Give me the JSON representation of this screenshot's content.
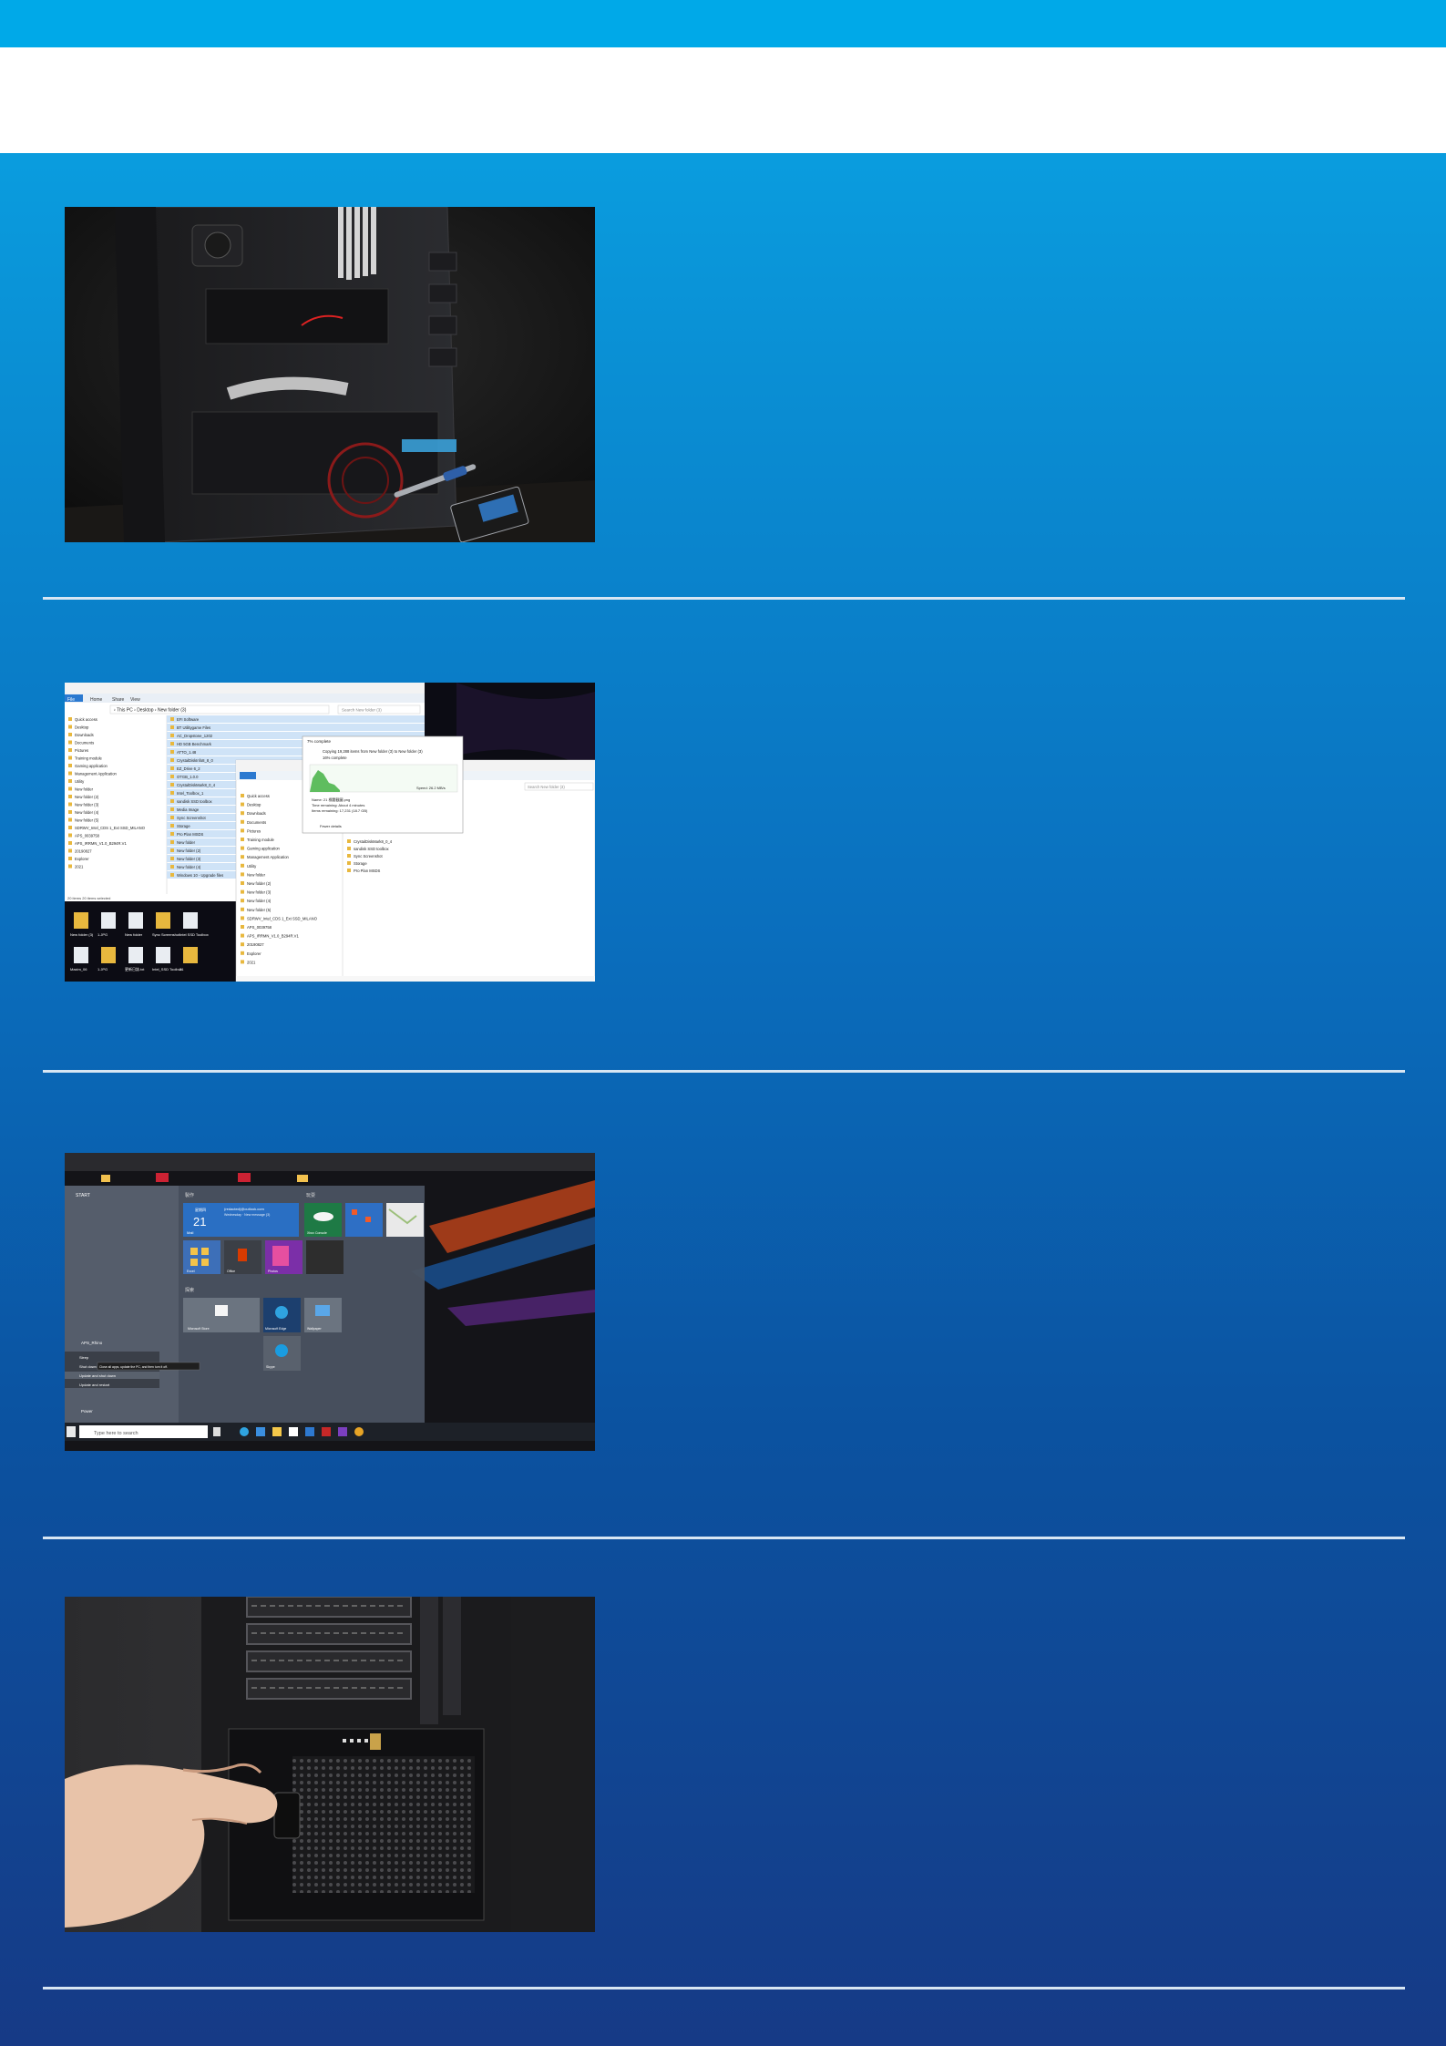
{
  "colors": {
    "top_band": "#00a9e8",
    "white_band": "#ffffff",
    "divider": "#d8e6f3",
    "background_top": "#0aa6e6",
    "background_bottom": "#163a86"
  },
  "panels": [
    {
      "kind": "photo-pc-case-with-ssd"
    },
    {
      "kind": "screenshot-file-copy",
      "explorer_back": {
        "menu": [
          "File",
          "Home",
          "Share",
          "View"
        ],
        "path": "› This PC › Desktop › New folder (3)",
        "search": "Search New folder (3)",
        "nav": [
          "Quick access",
          "Desktop",
          "Downloads",
          "Documents",
          "Pictures",
          "Training module",
          "Gaming application",
          "Management Application",
          "Utility",
          "New folder",
          "New folder (2)",
          "New folder (3)",
          "New folder (4)",
          "New folder (5)",
          "SDRWV_Intel_CDS 1_Ext SSD_MILANO",
          "APS_0039758",
          "APS_IRRMN_V1.0_B294R.V1",
          "20190827",
          "Explorer",
          "2021"
        ],
        "status": "20 items    20 items selected",
        "files": [
          "EFI Software",
          "BT Utilitygame Files",
          "AC_Dropstone_1202",
          "HD 5GB Benchmark",
          "ATTO_1.48",
          "CrystalDiskInfo8_8_0",
          "EZ_Drive 6_2",
          "OTGB_1.0.0",
          "CrystalDiskMark8_0_4",
          "Intel_Toolbox_1",
          "sandisk SSD toolbox",
          "Media Image",
          "Sync Screenshot",
          "Storage",
          "Pro Plan MSDS",
          "New folder",
          "New folder (2)",
          "New folder (3)",
          "New folder (4)",
          "Windows 10 - Upgrade files"
        ]
      },
      "explorer_front": {
        "search": "Search New folder (3)",
        "nav": [
          "Quick access",
          "Desktop",
          "Downloads",
          "Documents",
          "Pictures",
          "Training module",
          "Gaming application",
          "Management Application",
          "Utility",
          "New folder",
          "New folder (2)",
          "New folder (3)",
          "New folder (4)",
          "New folder (5)",
          "SDRWV_Intel_CDS 1_Ext SSD_MILANO",
          "APS_0039758",
          "APS_IRRMN_V1.0_B294R.V1",
          "20190827",
          "Explorer",
          "2021"
        ],
        "files": [
          "CrystalDiskMark8_0_4",
          "sandisk SSD toolbox",
          "Sync Screenshot",
          "Storage",
          "Pro Plan MSDS"
        ]
      },
      "copy_dialog": {
        "title": "7% complete",
        "line1": "Copying 19,288 items from New folder (3) to New folder (3)",
        "line2": "16% complete",
        "speed": "Speed: 26.2 MB/s",
        "name": "Name: 21 標題截圖.png",
        "time": "Time remaining: About 4 minutes",
        "items": "Items remaining: 17,231 (18.7 GB)",
        "fewer": "Fewer details"
      },
      "desktop_icons": [
        "New folder (3)",
        "1.JPG",
        "New folder",
        "Sync Screenshot",
        "Intel SSD Toolbox",
        "Maxim_06",
        "1.JPG",
        "更新日誌.txt",
        "Intel_SSD Toolbox",
        "21"
      ]
    },
    {
      "kind": "screenshot-start-menu",
      "start_header": "START",
      "section_left": "製作",
      "section_right": "玩耍",
      "section_lower": "探索",
      "mail_user": "(redacted)@outlook.com",
      "mail_line1": "Wednesday · New message (3)",
      "calendar_day": "21",
      "calendar_weekday": "星期四",
      "mail_label": "Mail",
      "tiles": [
        "Excel",
        "Office",
        "Photos",
        "Xbox Console",
        "Microsoft Store",
        "Microsoft Edge",
        "Wallpaper",
        "Skype"
      ],
      "power_user": "APS_Rhino",
      "power_menu": [
        "Sleep",
        "Shut down",
        "Update and shut down",
        "Update and restart"
      ],
      "tooltip": "Close all apps, update the PC, and then turn it off.",
      "power_label": "Power",
      "search_placeholder": "Type here to search"
    },
    {
      "kind": "photo-psu-switch"
    }
  ]
}
